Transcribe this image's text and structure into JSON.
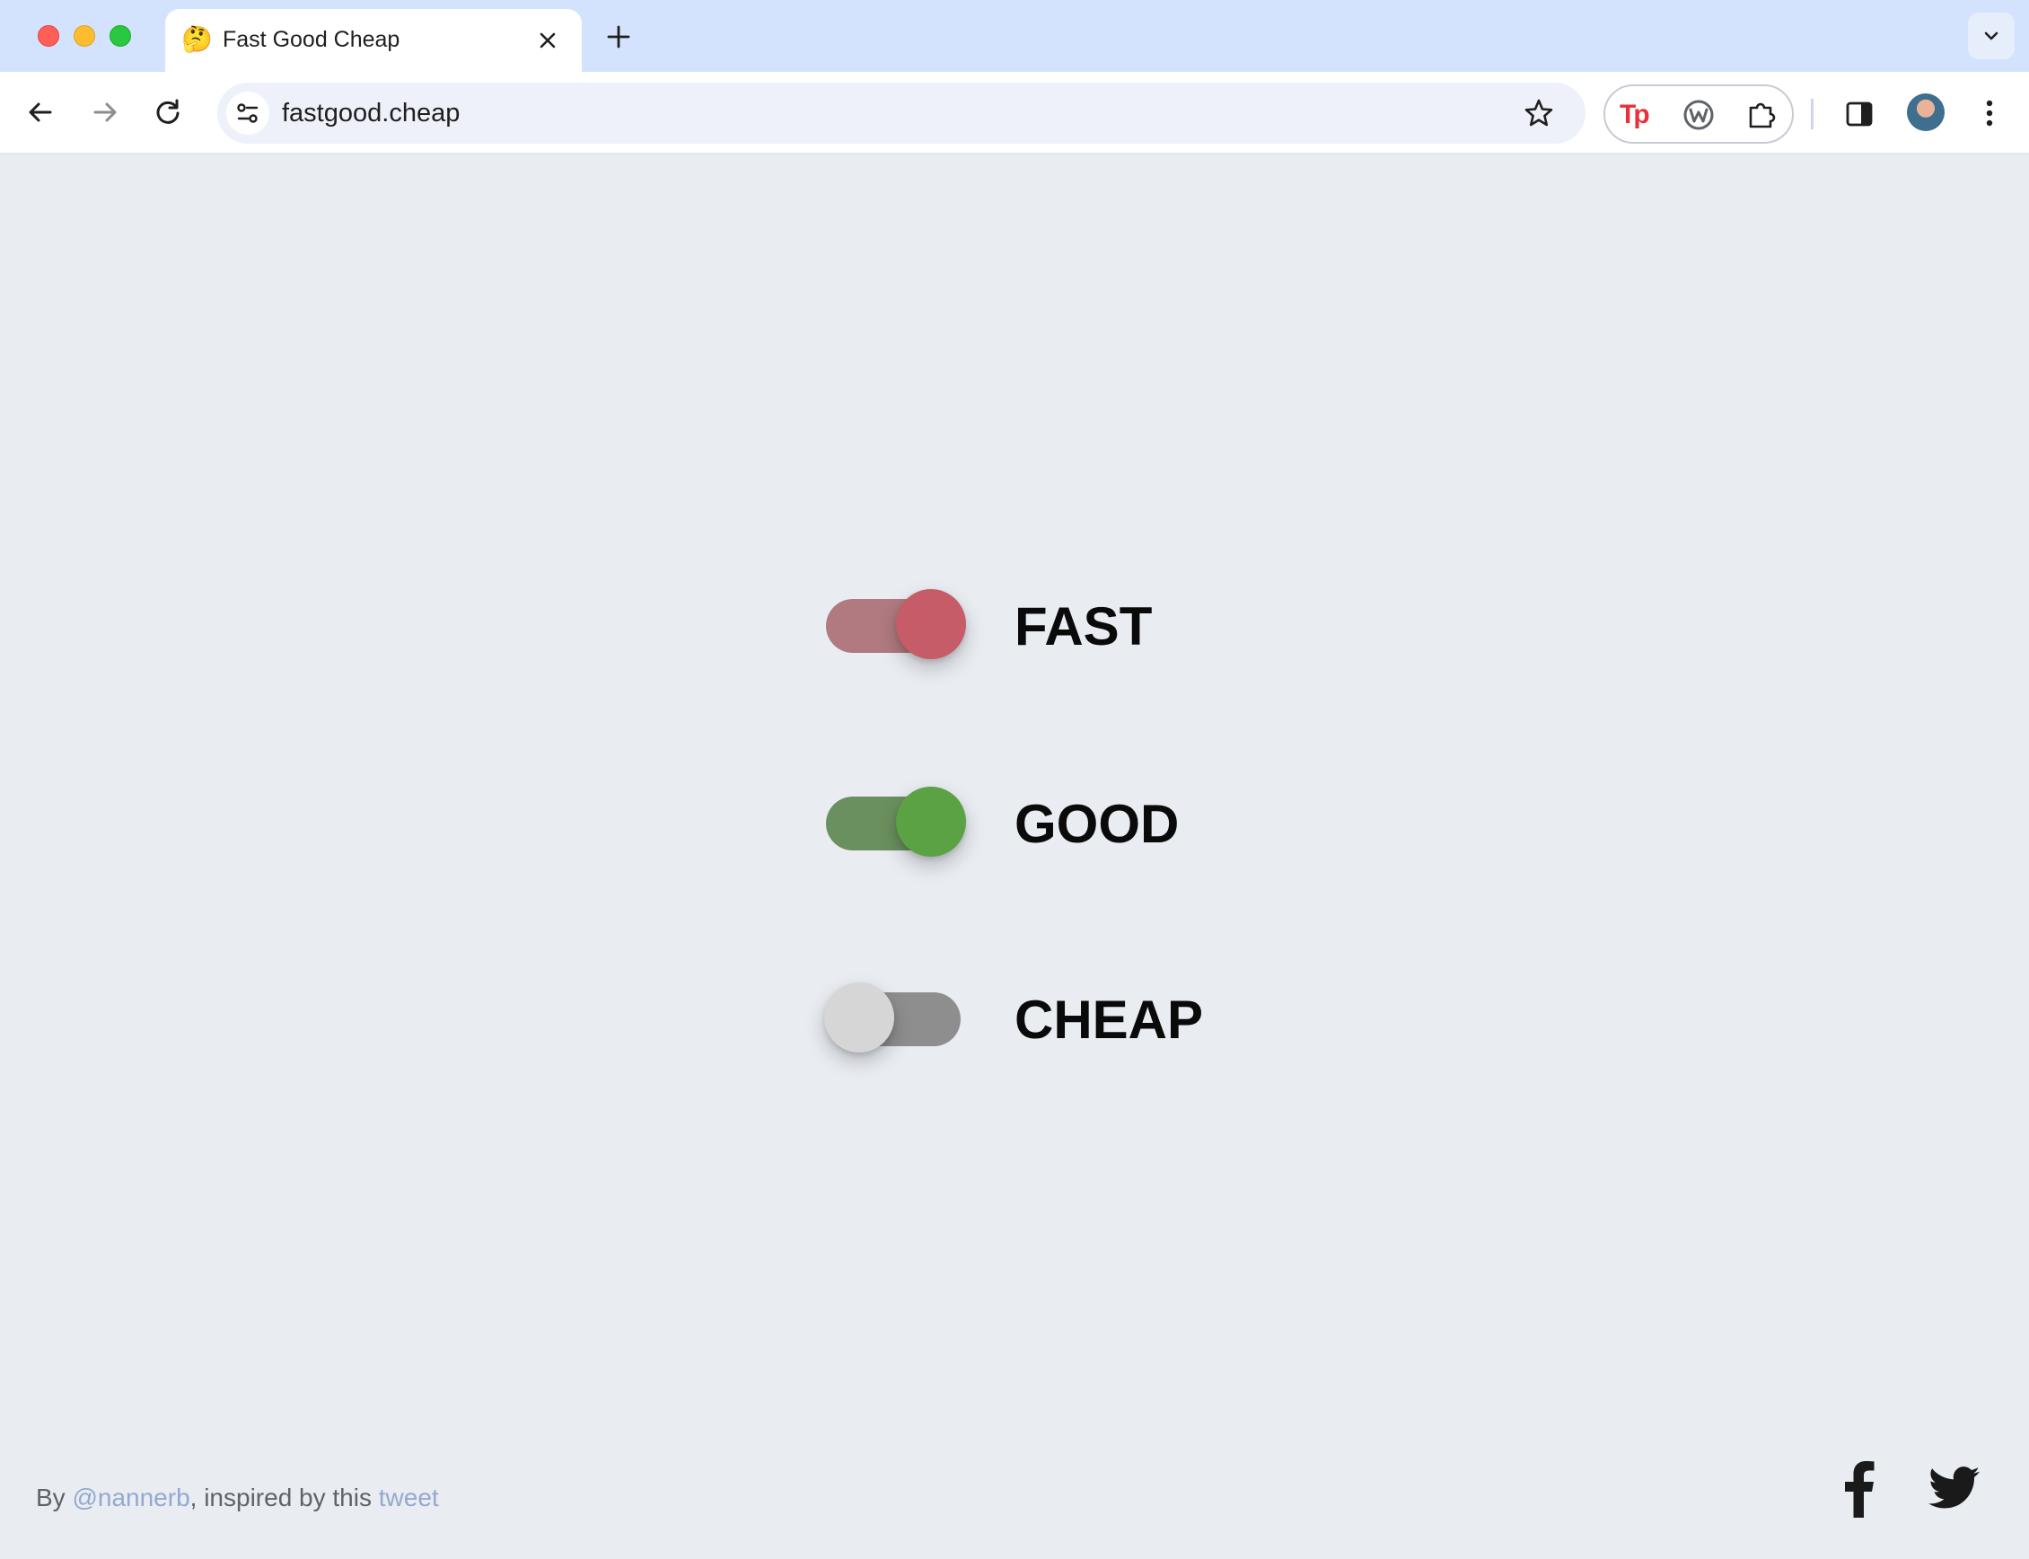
{
  "browser": {
    "tab": {
      "favicon": "🤔",
      "title": "Fast Good Cheap"
    },
    "address_bar": {
      "url": "fastgood.cheap"
    },
    "extensions": {
      "tp_label": "Tp"
    }
  },
  "toggles": [
    {
      "label": "FAST",
      "on": true,
      "track_color": "#b07a80",
      "knob_color": "#c65c67"
    },
    {
      "label": "GOOD",
      "on": true,
      "track_color": "#6b905f",
      "knob_color": "#5aa244"
    },
    {
      "label": "CHEAP",
      "on": false,
      "track_color": "#8e8e8e",
      "knob_color": "#d6d6d6"
    }
  ],
  "footer": {
    "by_prefix": "By ",
    "author_link": "@nannerb",
    "middle_text": ", inspired by this ",
    "tweet_link": "tweet",
    "link_color": "#93a9cf"
  },
  "icons": {
    "back": "arrow-left-icon",
    "forward": "arrow-right-icon",
    "reload": "reload-icon",
    "site_info": "tune-icon",
    "bookmark": "star-icon",
    "extensions": "puzzle-icon",
    "side_panel": "side-panel-icon",
    "menu": "kebab-menu-icon",
    "facebook": "facebook-icon",
    "twitter": "twitter-icon"
  }
}
